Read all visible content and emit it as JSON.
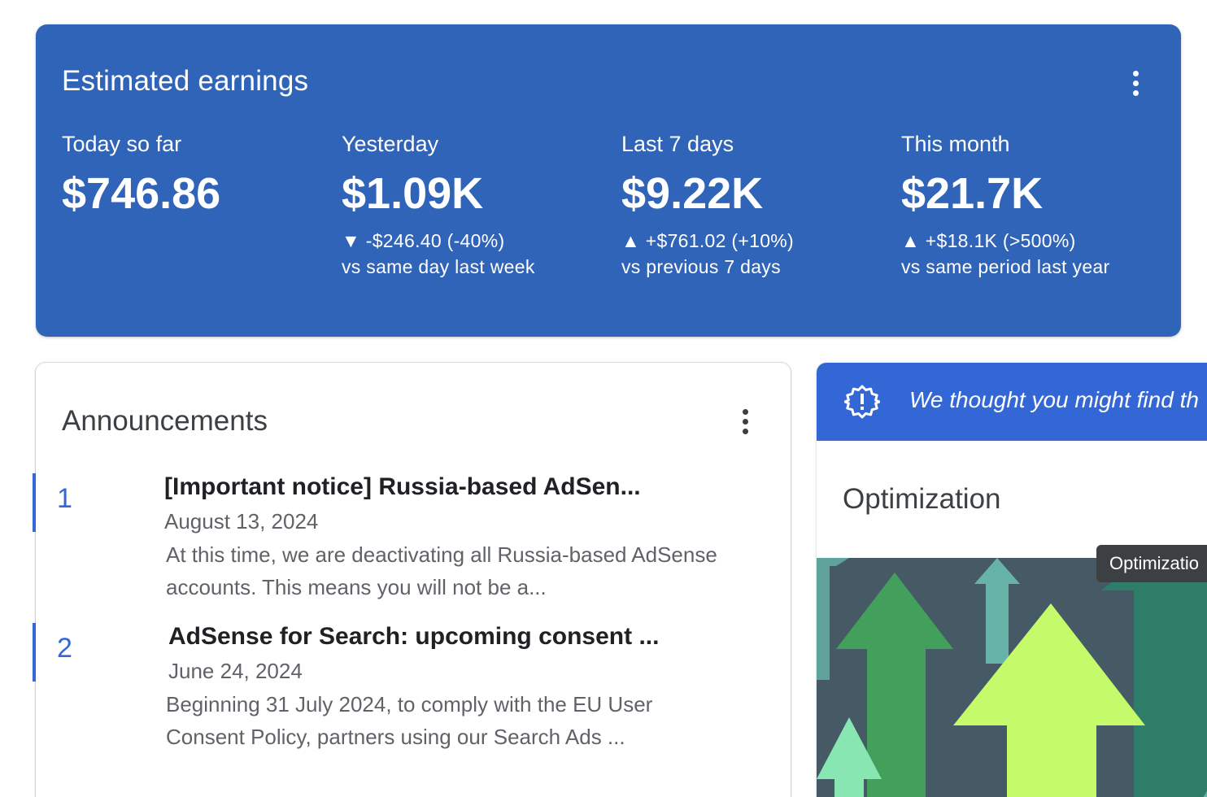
{
  "earnings": {
    "title": "Estimated earnings",
    "menu_icon": "more-vert-icon",
    "metrics": [
      {
        "label": "Today so far",
        "value": "$746.86",
        "change": "",
        "compare": ""
      },
      {
        "label": "Yesterday",
        "value": "$1.09K",
        "change": "▼ -$246.40 (-40%)",
        "compare": "vs same day last week"
      },
      {
        "label": "Last 7 days",
        "value": "$9.22K",
        "change": "▲ +$761.02 (+10%)",
        "compare": "vs previous 7 days"
      },
      {
        "label": "This month",
        "value": "$21.7K",
        "change": "▲ +$18.1K (>500%)",
        "compare": "vs same period last year"
      }
    ]
  },
  "announcements": {
    "title": "Announcements",
    "items": [
      {
        "number": "1",
        "headline": "[Important notice] Russia-based AdSen...",
        "date": "August 13, 2024",
        "body": "At this time, we are deactivating all Russia-based AdSense accounts. This means you will not be a..."
      },
      {
        "number": "2",
        "headline": "AdSense for Search: upcoming consent ...",
        "date": "June 24, 2024",
        "body": "Beginning 31 July 2024, to comply with the EU User Consent Policy, partners using our Search Ads ..."
      }
    ]
  },
  "optimization": {
    "banner_text": "We thought you might find th",
    "banner_icon": "alert-badge-icon",
    "title": "Optimization",
    "tooltip": "Optimizatio",
    "illustration_icon": "growth-arrows-illustration"
  },
  "colors": {
    "earnings_bg": "#3064b9",
    "accent": "#3367d6",
    "illus_bg": "#455a64"
  }
}
